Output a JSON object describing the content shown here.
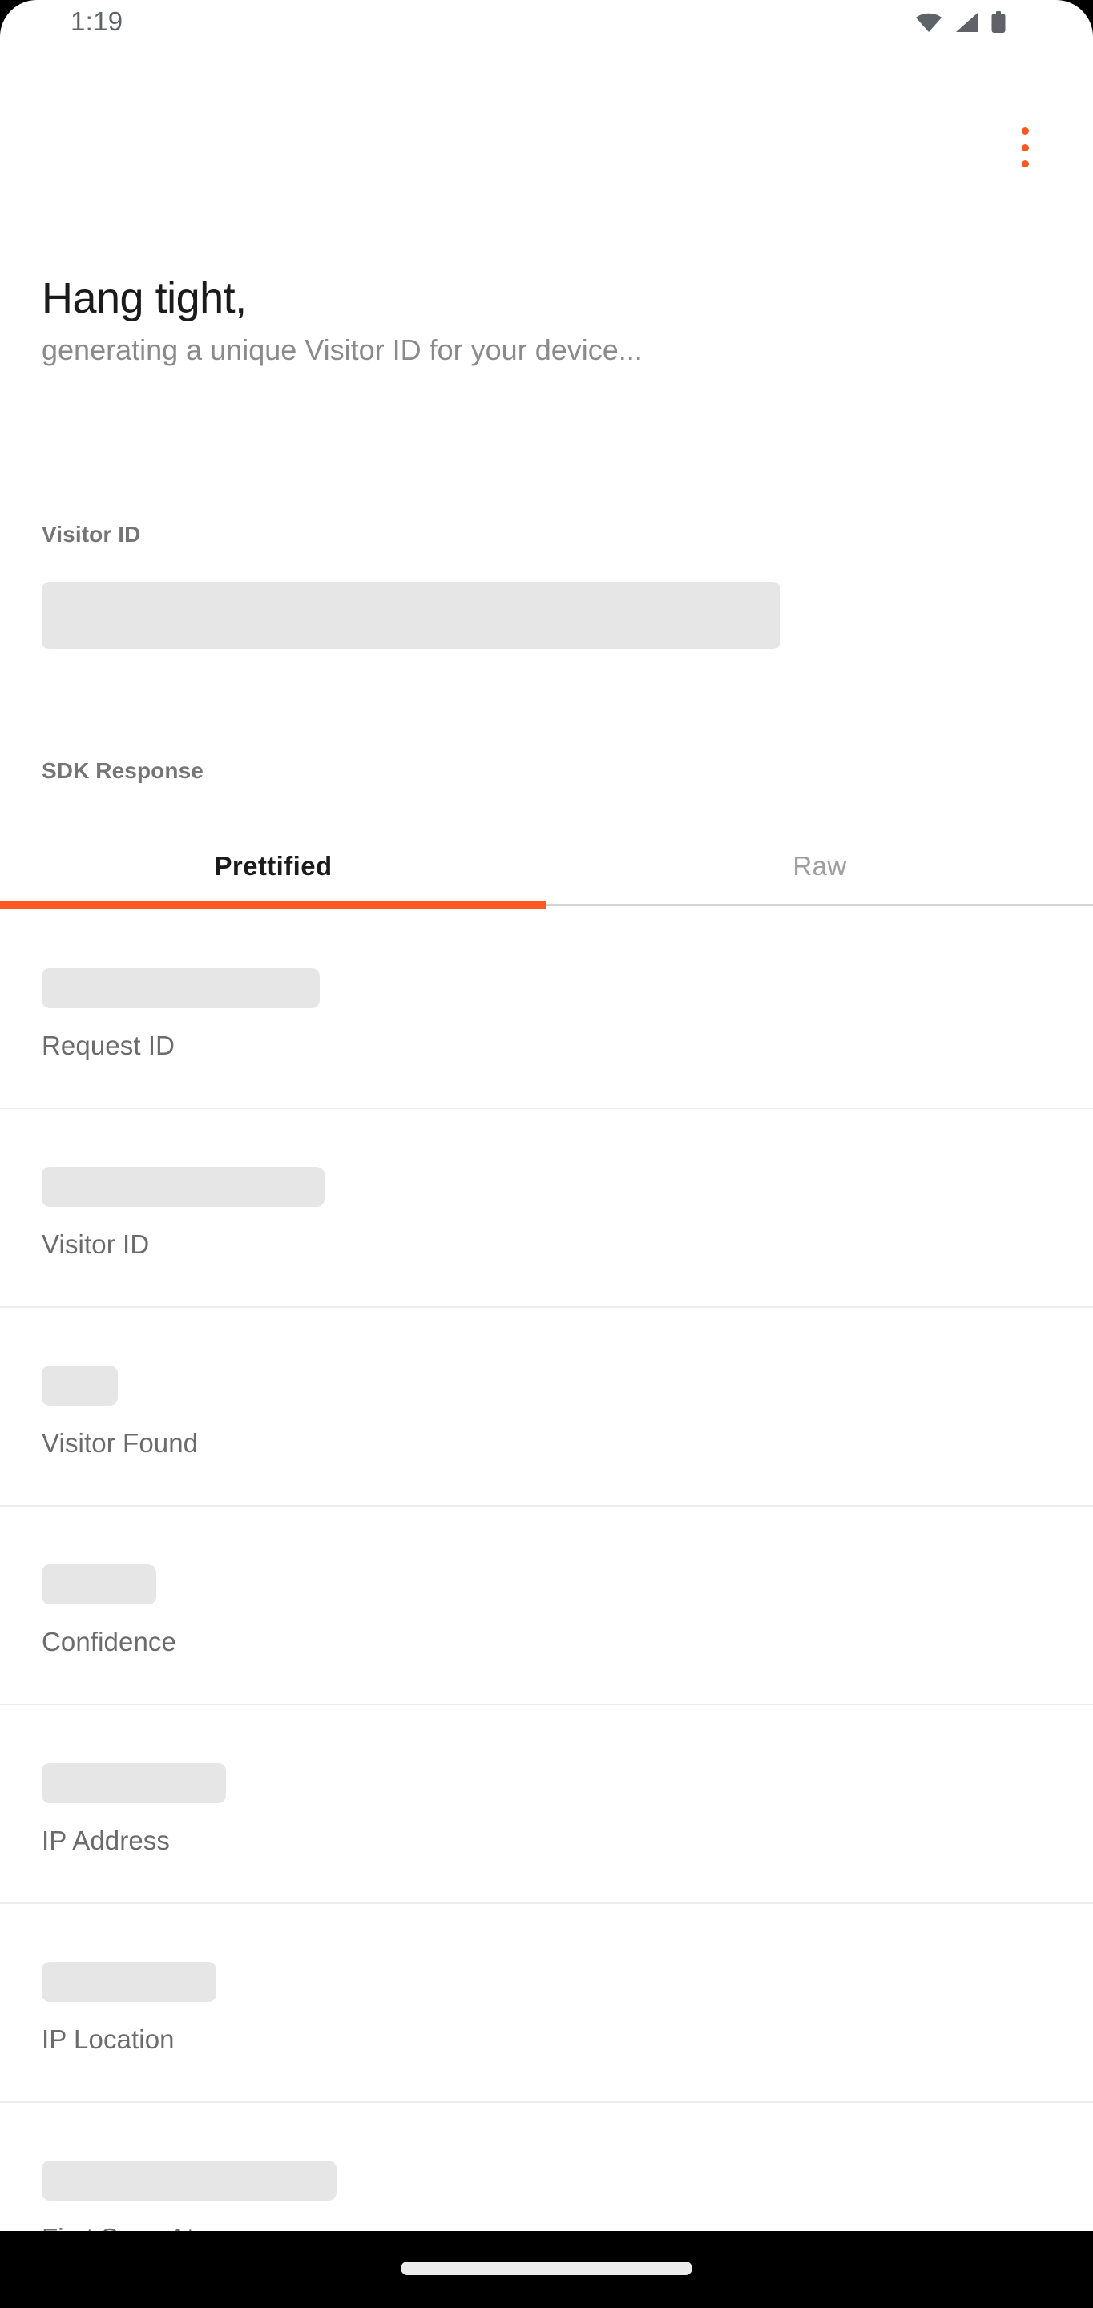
{
  "status_bar": {
    "time": "1:19",
    "icons": [
      "wifi-icon",
      "cellular-signal-icon",
      "battery-icon"
    ]
  },
  "app_bar": {
    "overflow_menu_label": "More options",
    "overflow_menu_icon": "more-vert-icon",
    "accent_color": "#FF5722"
  },
  "header": {
    "title": "Hang tight,",
    "subtitle": "generating a unique Visitor ID for your device..."
  },
  "visitor_id_section": {
    "label": "Visitor ID",
    "value": "",
    "loading": true
  },
  "sdk_response": {
    "label": "SDK Response",
    "tabs": [
      {
        "label": "Prettified",
        "active": true
      },
      {
        "label": "Raw",
        "active": false
      }
    ],
    "indicator_color": "#FF5722",
    "rows": [
      {
        "label": "Request ID",
        "value": "",
        "skeleton_width": 347
      },
      {
        "label": "Visitor ID",
        "value": "",
        "skeleton_width": 353
      },
      {
        "label": "Visitor Found",
        "value": "",
        "skeleton_width": 95
      },
      {
        "label": "Confidence",
        "value": "",
        "skeleton_width": 143
      },
      {
        "label": "IP Address",
        "value": "",
        "skeleton_width": 230
      },
      {
        "label": "IP Location",
        "value": "",
        "skeleton_width": 218
      },
      {
        "label": "First Seen At",
        "value": "",
        "skeleton_width": 368
      }
    ]
  },
  "nav_bar": {
    "gesture_pill": "home-gesture-pill",
    "background_color": "#000000"
  },
  "skeleton_color": "#E6E6E6"
}
